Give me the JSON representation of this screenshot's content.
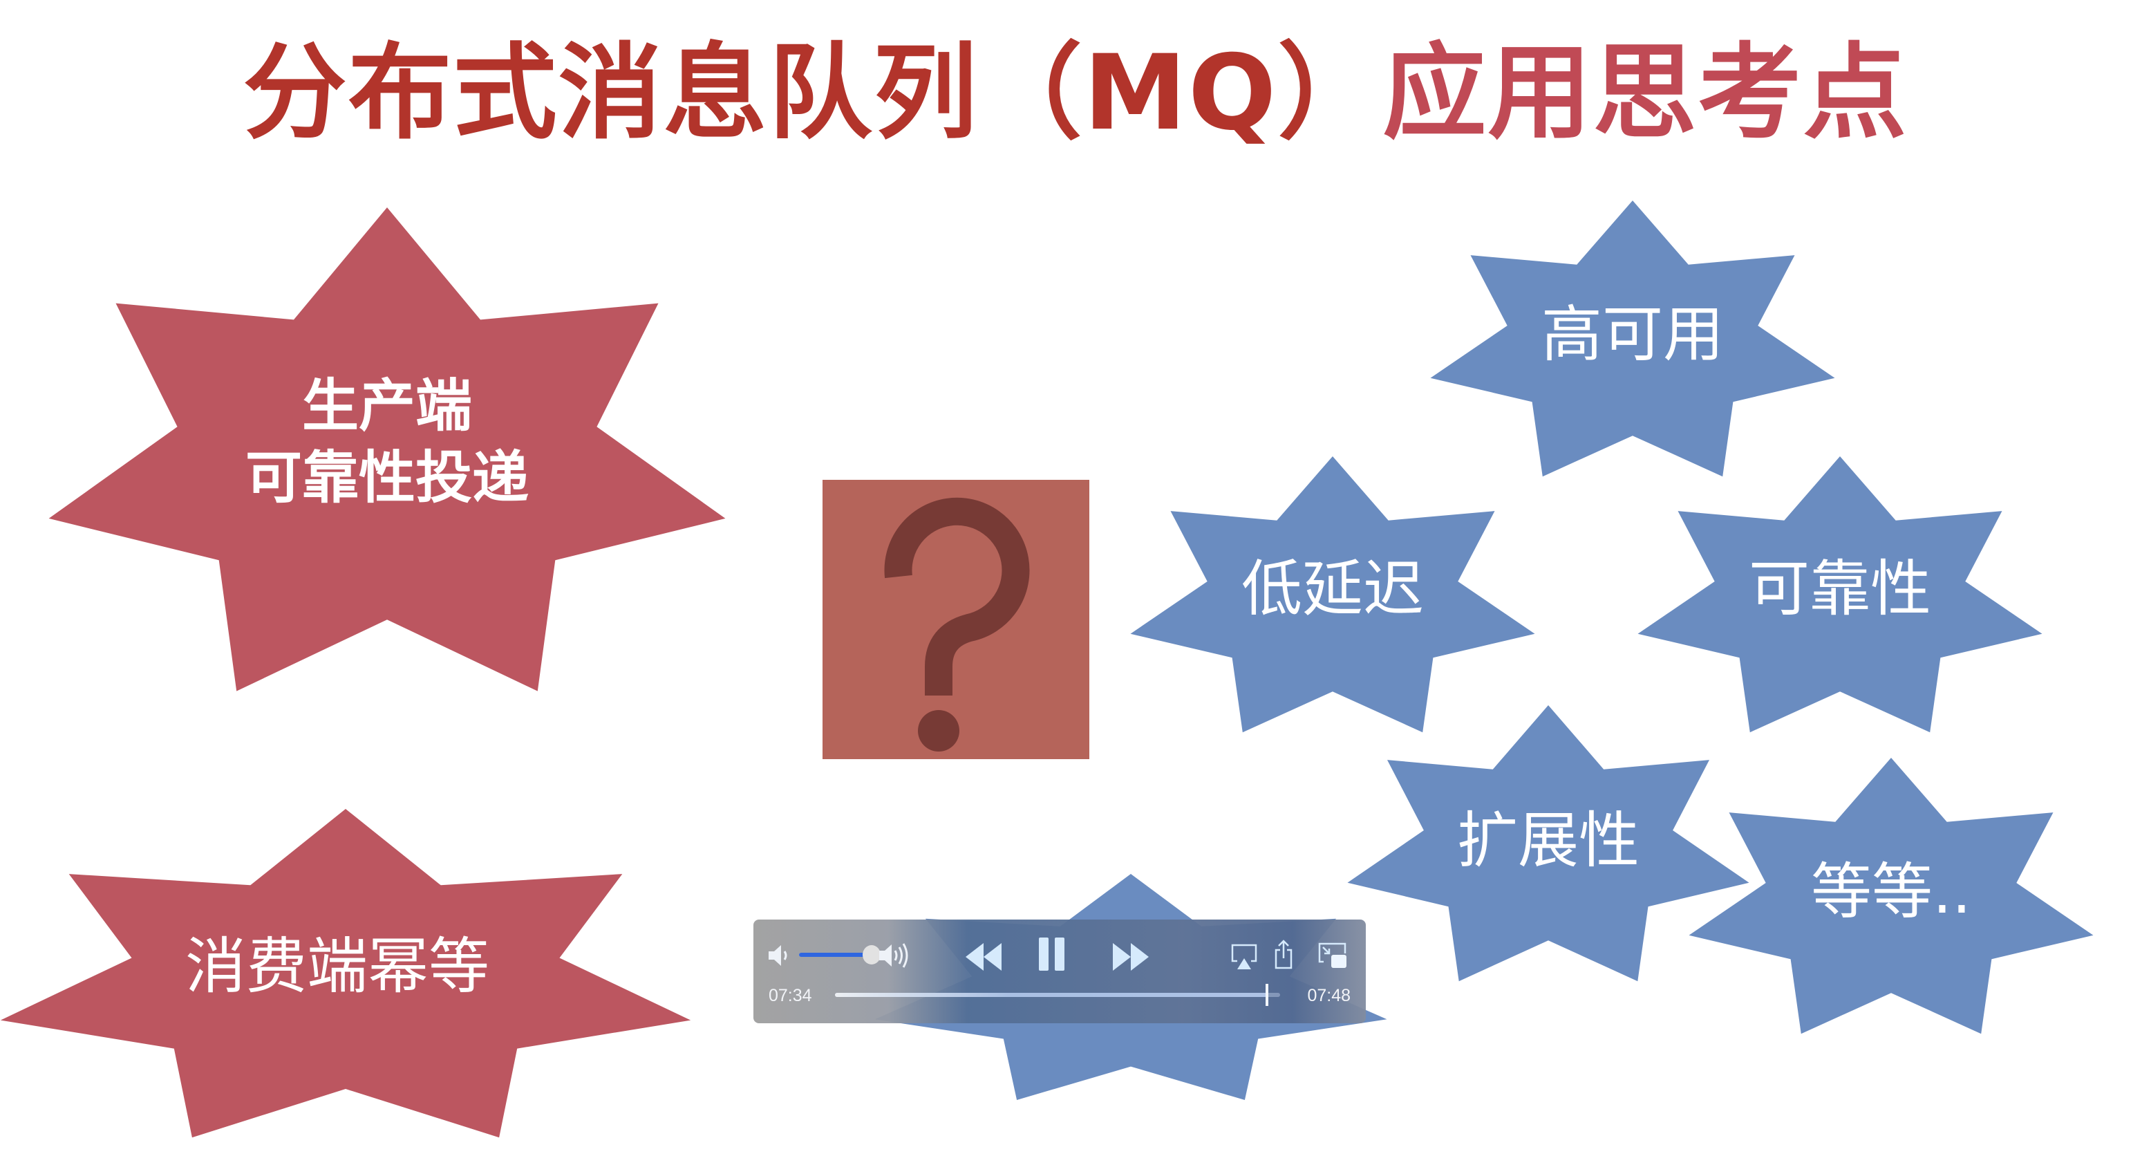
{
  "title": {
    "part1": "分布式消息队列（MQ）",
    "part2": "应用思考点"
  },
  "colors": {
    "red_star": "#BC5660",
    "blue_star": "#6A8CC0",
    "question_box": "#B5645A",
    "question_mark": "#773A35"
  },
  "red_stars": [
    {
      "line1": "生产端",
      "line2": "可靠性投递"
    },
    {
      "label": "消费端幂等"
    }
  ],
  "blue_stars": [
    {
      "label": "高可用"
    },
    {
      "label": "低延迟"
    },
    {
      "label": "可靠性"
    },
    {
      "label": "扩展性"
    },
    {
      "label": "等等.."
    }
  ],
  "player": {
    "current_time": "07:34",
    "total_time": "07:48",
    "progress_fraction": 0.97,
    "volume_fraction": 0.95,
    "icons": [
      "volume-low-icon",
      "volume-high-icon",
      "rewind-icon",
      "pause-icon",
      "fast-forward-icon",
      "airplay-icon",
      "share-icon",
      "picture-in-picture-icon"
    ]
  }
}
